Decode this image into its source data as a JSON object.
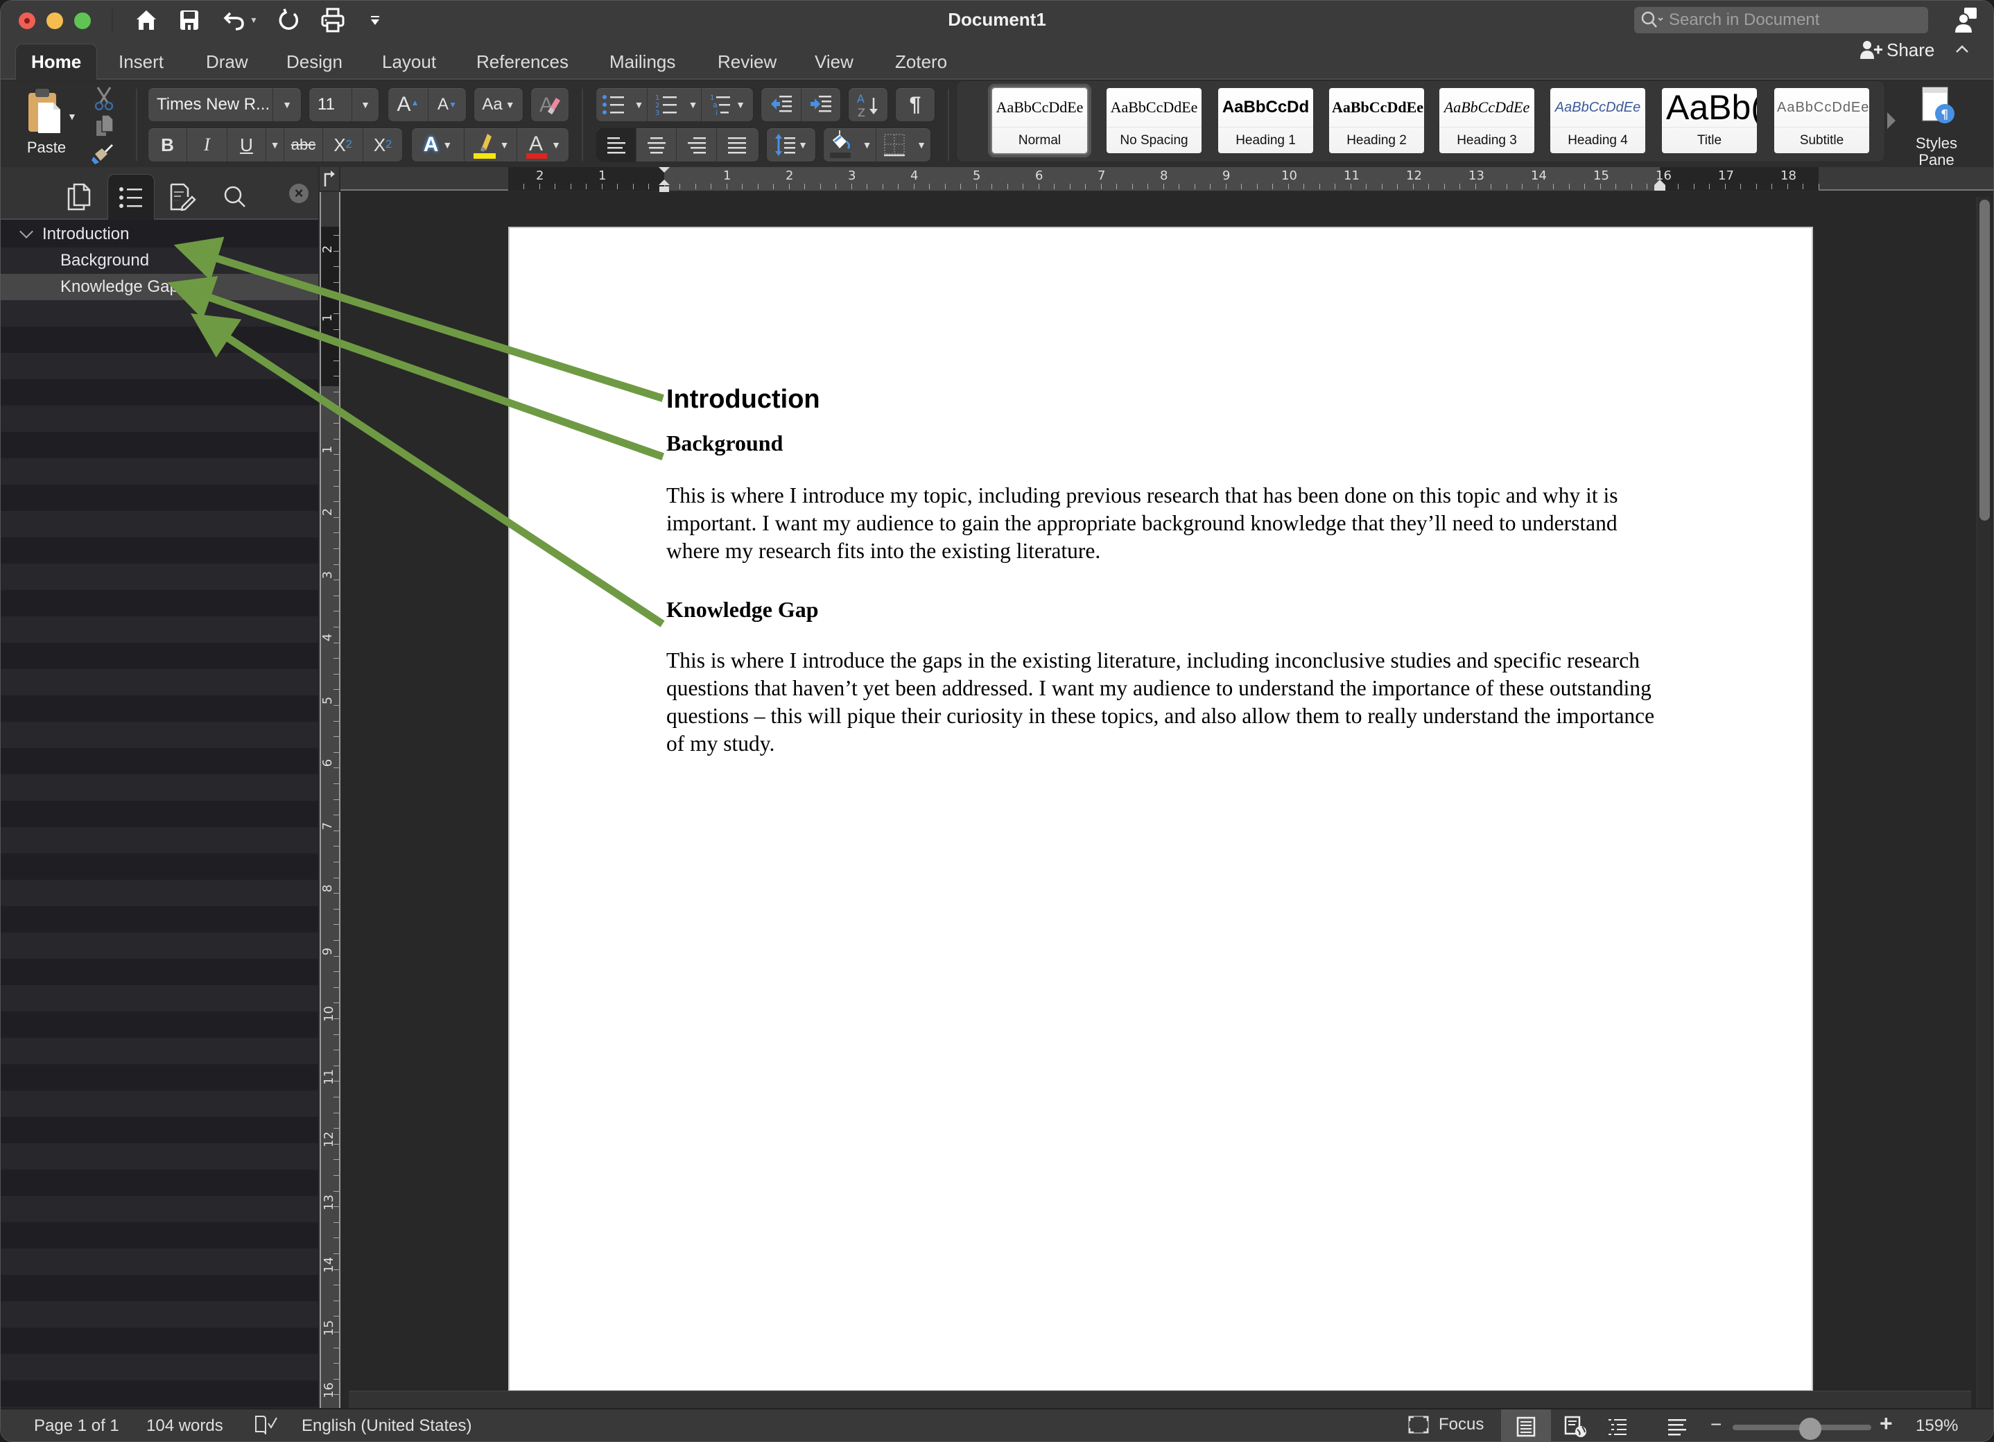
{
  "app": {
    "title": "Document1",
    "search_placeholder": "Search in Document"
  },
  "quick_access": [
    "home-icon",
    "save-icon",
    "undo-icon",
    "redo-icon",
    "print-icon",
    "customize-icon"
  ],
  "tabs": [
    {
      "label": "Home",
      "active": true
    },
    {
      "label": "Insert"
    },
    {
      "label": "Draw"
    },
    {
      "label": "Design"
    },
    {
      "label": "Layout"
    },
    {
      "label": "References"
    },
    {
      "label": "Mailings"
    },
    {
      "label": "Review"
    },
    {
      "label": "View"
    },
    {
      "label": "Zotero"
    }
  ],
  "share_label": "Share",
  "ribbon": {
    "paste_label": "Paste",
    "font_name": "Times New R...",
    "font_size": "11",
    "bold": "B",
    "italic": "I",
    "underline": "U",
    "strikethrough": "abc",
    "subscript": "X",
    "subscript_sub": "2",
    "superscript": "X",
    "superscript_sup": "2",
    "grow_font": "A",
    "shrink_font": "A",
    "change_case": "Aa",
    "font_color": "A",
    "text_effects": "A",
    "pilcrow": "¶",
    "styles": [
      {
        "sample": "AaBbCcDdEe",
        "name": "Normal",
        "selected": true
      },
      {
        "sample": "AaBbCcDdEe",
        "name": "No Spacing"
      },
      {
        "sample": "AaBbCcDd",
        "name": "Heading 1"
      },
      {
        "sample": "AaBbCcDdEe",
        "name": "Heading 2"
      },
      {
        "sample": "AaBbCcDdEe",
        "name": "Heading 3"
      },
      {
        "sample": "AaBbCcDdEe",
        "name": "Heading 4"
      },
      {
        "sample": "AaBb(",
        "name": "Title"
      },
      {
        "sample": "AaBbCcDdEe",
        "name": "Subtitle"
      }
    ],
    "styles_pane_label_1": "Styles",
    "styles_pane_label_2": "Pane",
    "colors": {
      "highlight": "#f5e511",
      "font_color": "#e0231c",
      "accent_blue": "#4a90e2"
    }
  },
  "navigation": {
    "items": [
      {
        "label": "Introduction",
        "level": 1,
        "expanded": true
      },
      {
        "label": "Background",
        "level": 2
      },
      {
        "label": "Knowledge Gap",
        "level": 2,
        "selected": true
      }
    ]
  },
  "rulers": {
    "horizontal_left": [
      "2",
      "1"
    ],
    "horizontal": [
      "1",
      "2",
      "3",
      "4",
      "5",
      "6",
      "7",
      "8",
      "9",
      "10",
      "11",
      "12",
      "13",
      "14",
      "15",
      "16",
      "17",
      "18"
    ],
    "vertical_top": [
      "2",
      "1"
    ],
    "vertical": [
      "1",
      "2",
      "3",
      "4",
      "5",
      "6",
      "7",
      "8",
      "9",
      "10",
      "11",
      "12",
      "13",
      "14",
      "15",
      "16"
    ]
  },
  "document": {
    "heading1": "Introduction",
    "sections": [
      {
        "heading": "Background",
        "body": "This is where I introduce my topic, including previous research that has been done on this topic and why it is important. I want my audience to gain the appropriate background knowledge that they’ll need to understand where my research fits into the existing literature."
      },
      {
        "heading": "Knowledge Gap",
        "body": "This is where I introduce the gaps in the existing literature, including inconclusive studies and specific research questions that haven’t yet been addressed. I want my audience to understand the importance of these outstanding questions – this will pique their curiosity in these topics, and also allow them to really understand the importance of my study."
      }
    ]
  },
  "annotation": {
    "arrow_color": "#6f9a44",
    "arrows": [
      {
        "from": "document.heading1",
        "to": "navigation.items.0"
      },
      {
        "from": "document.sections.0.heading",
        "to": "navigation.items.1"
      },
      {
        "from": "document.sections.1.heading",
        "to": "navigation.items.2"
      }
    ]
  },
  "status": {
    "page": "Page 1 of 1",
    "words": "104 words",
    "language": "English (United States)",
    "focus": "Focus",
    "zoom": "159%",
    "zoom_minus": "−",
    "zoom_plus": "+"
  }
}
